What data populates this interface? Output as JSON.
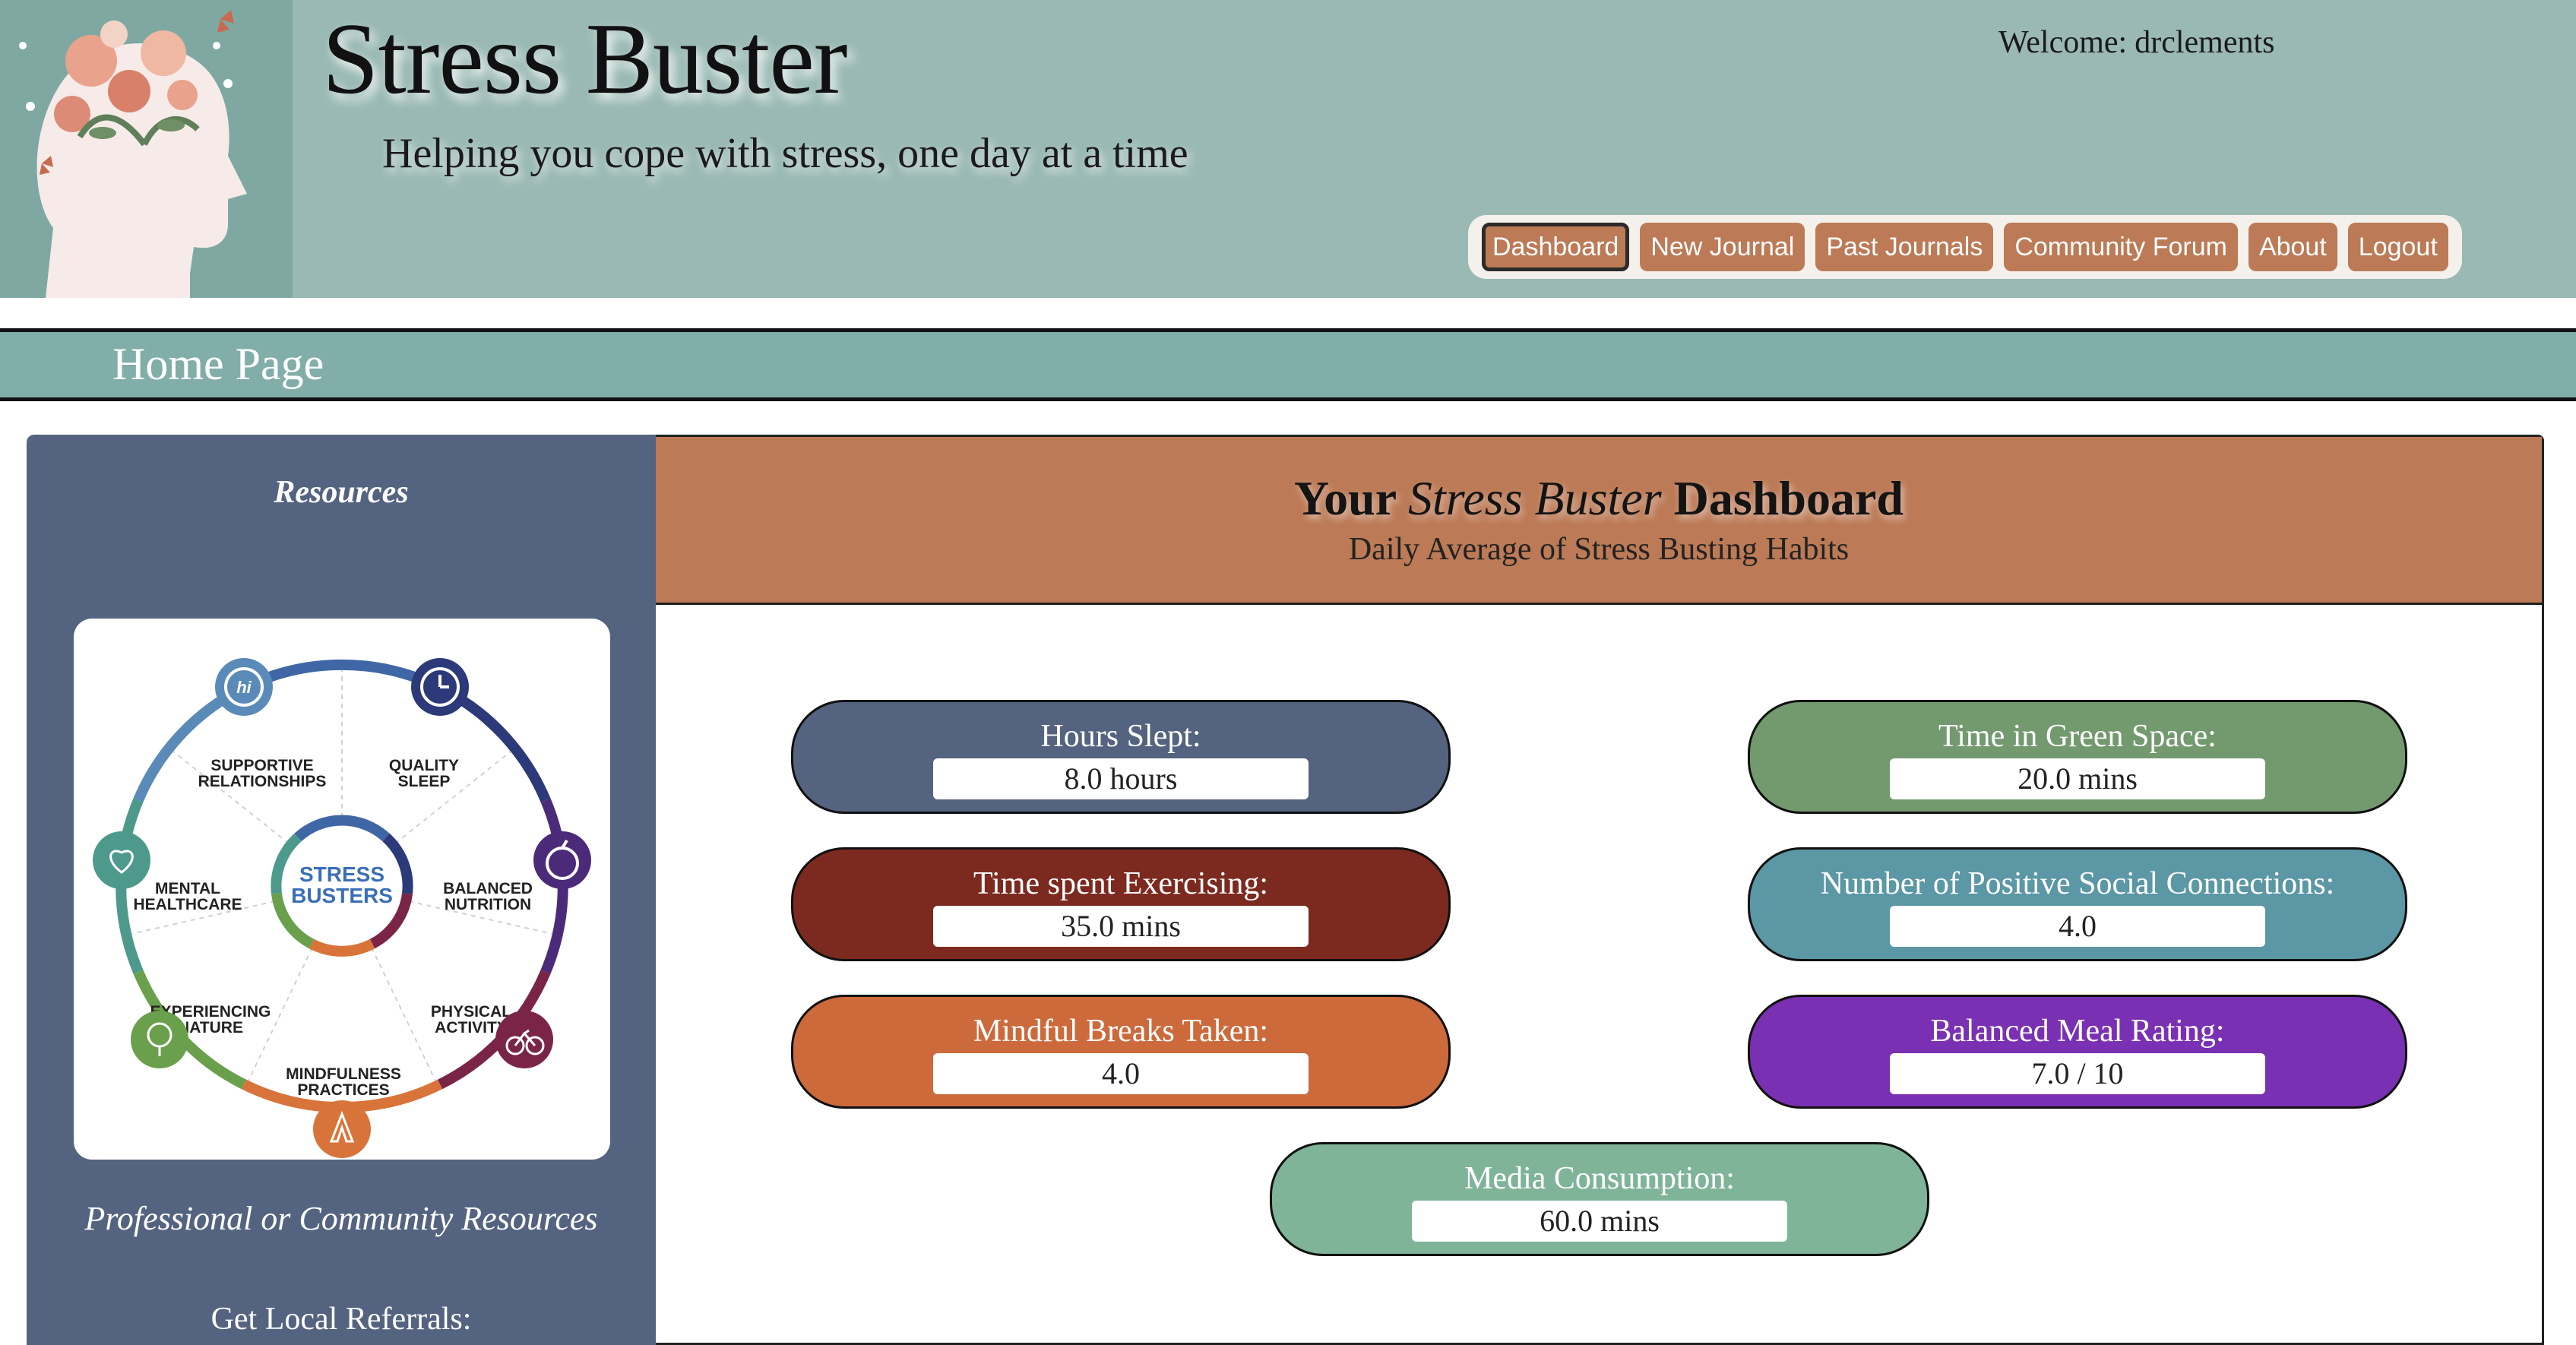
{
  "header": {
    "title": "Stress Buster",
    "tagline": "Helping you cope with stress, one day at a time",
    "welcome_label": "Welcome:",
    "username": "drclements"
  },
  "nav": {
    "items": [
      "Dashboard",
      "New Journal",
      "Past Journals",
      "Community Forum",
      "About",
      "Logout"
    ],
    "active": "Dashboard"
  },
  "page": {
    "heading": "Home Page"
  },
  "sidebar": {
    "title": "Resources",
    "wheel": {
      "center_line1": "STRESS",
      "center_line2": "BUSTERS",
      "segments": [
        {
          "line1": "SUPPORTIVE",
          "line2": "RELATIONSHIPS"
        },
        {
          "line1": "QUALITY",
          "line2": "SLEEP"
        },
        {
          "line1": "BALANCED",
          "line2": "NUTRITION"
        },
        {
          "line1": "PHYSICAL",
          "line2": "ACTIVITY"
        },
        {
          "line1": "MINDFULNESS",
          "line2": "PRACTICES"
        },
        {
          "line1": "EXPERIENCING",
          "line2": "NATURE"
        },
        {
          "line1": "MENTAL",
          "line2": "HEALTHCARE"
        }
      ],
      "icon_names": [
        "hi-speech-icon",
        "clock-icon",
        "apple-icon",
        "bicycle-icon",
        "praying-hands-icon",
        "tree-icon",
        "heart-icon"
      ]
    },
    "professional_label": "Professional or Community Resources",
    "referrals_label": "Get Local Referrals:"
  },
  "dashboard": {
    "title_prefix": "Your",
    "title_em": "Stress Buster",
    "title_suffix": "Dashboard",
    "subtitle": "Daily Average of Stress Busting Habits",
    "metrics": [
      {
        "label": "Hours Slept:",
        "value": "8.0 hours",
        "color": "#54637f"
      },
      {
        "label": "Time in Green Space:",
        "value": "20.0 mins",
        "color": "#739a6f"
      },
      {
        "label": "Time spent Exercising:",
        "value": "35.0 mins",
        "color": "#7c2a1f"
      },
      {
        "label": "Number of Positive Social Connections:",
        "value": "4.0",
        "color": "#5b97a5"
      },
      {
        "label": "Mindful Breaks Taken:",
        "value": "4.0",
        "color": "#cc6a3c"
      },
      {
        "label": "Balanced Meal Rating:",
        "value": "7.0 / 10",
        "color": "#7a30b3"
      },
      {
        "label": "Media Consumption:",
        "value": "60.0 mins",
        "color": "#7fb499"
      }
    ]
  },
  "colors": {
    "header_bg": "#9ab9b4",
    "nav_button": "#bc7a56",
    "home_bar": "#82aea9",
    "sidebar_bg": "#54637f",
    "dash_header": "#bc7a56"
  }
}
